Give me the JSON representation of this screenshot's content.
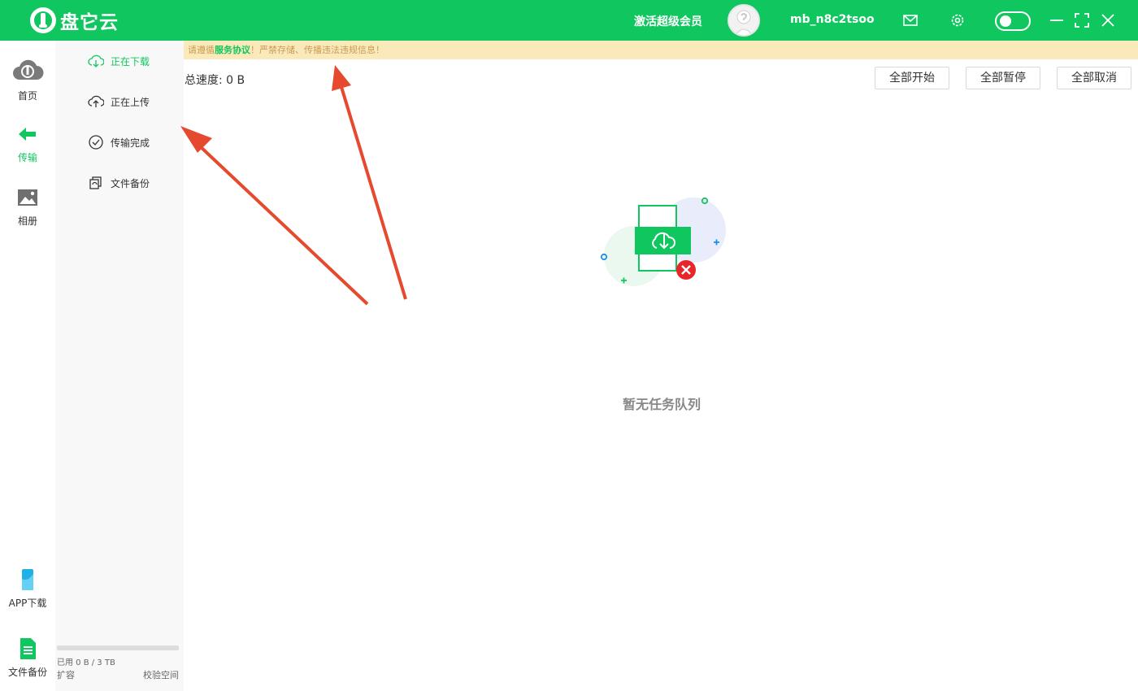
{
  "app": {
    "name": "盘它云",
    "vip_label": "激活超级会员",
    "username": "mb_n8c2tsoo"
  },
  "colors": {
    "brand": "#10c65f",
    "notice_bg": "#faeabb",
    "error": "#e8262a",
    "annotation": "#e64a2e"
  },
  "icons": [
    "cloud-logo-icon",
    "avatar-placeholder-icon",
    "mail-icon",
    "gear-icon",
    "minimize-icon",
    "maximize-icon",
    "close-icon"
  ],
  "left_nav": {
    "home": "首页",
    "transfer": "传输",
    "album": "相册",
    "app_download": "APP下载",
    "file_backup": "文件备份"
  },
  "sub_nav": {
    "downloading": "正在下载",
    "uploading": "正在上传",
    "completed": "传输完成",
    "backup": "文件备份"
  },
  "storage": {
    "used_text": "已用 0 B / 3 TB",
    "used_fraction": 0,
    "expand_label": "扩容",
    "verify_label": "校验空间"
  },
  "notice": {
    "prefix": "请遵循",
    "link": "服务协议",
    "suffix": "！严禁存储、传播违法违规信息！"
  },
  "toolbar": {
    "speed": "总速度: 0 B",
    "start_all": "全部开始",
    "pause_all": "全部暂停",
    "cancel_all": "全部取消"
  },
  "empty_state": {
    "text": "暂无任务队列"
  }
}
